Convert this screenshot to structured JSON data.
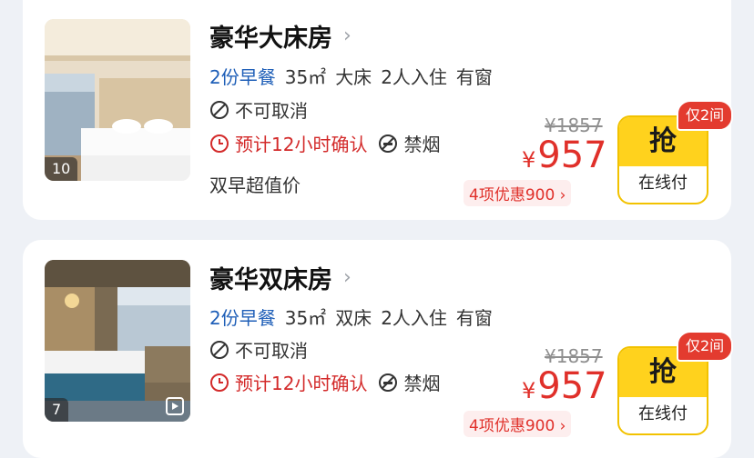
{
  "rooms": [
    {
      "name": "豪华大床房",
      "chevron": "›",
      "breakfast": "2份早餐",
      "area": "35㎡",
      "bed": "大床",
      "occupancy": "2人入住",
      "window": "有窗",
      "cancel_policy": "不可取消",
      "confirm": "预计12小时确认",
      "smoking": "禁烟",
      "tagline": "双早超值价",
      "original_price": "¥1857",
      "currency": "¥",
      "price": "957",
      "promo": "4项优惠900 ›",
      "grab_label": "抢",
      "pay_label": "在线付",
      "stock_badge": "仅2间",
      "photo_count": "10"
    },
    {
      "name": "豪华双床房",
      "chevron": "›",
      "breakfast": "2份早餐",
      "area": "35㎡",
      "bed": "双床",
      "occupancy": "2人入住",
      "window": "有窗",
      "cancel_policy": "不可取消",
      "confirm": "预计12小时确认",
      "smoking": "禁烟",
      "original_price": "¥1857",
      "currency": "¥",
      "price": "957",
      "promo": "4项优惠900 ›",
      "grab_label": "抢",
      "pay_label": "在线付",
      "stock_badge": "仅2间",
      "photo_count": "7"
    }
  ],
  "colors": {
    "accent_blue": "#1f5fb8",
    "price_red": "#e0302a",
    "button_yellow": "#ffd21d",
    "badge_red": "#e33b2f"
  }
}
